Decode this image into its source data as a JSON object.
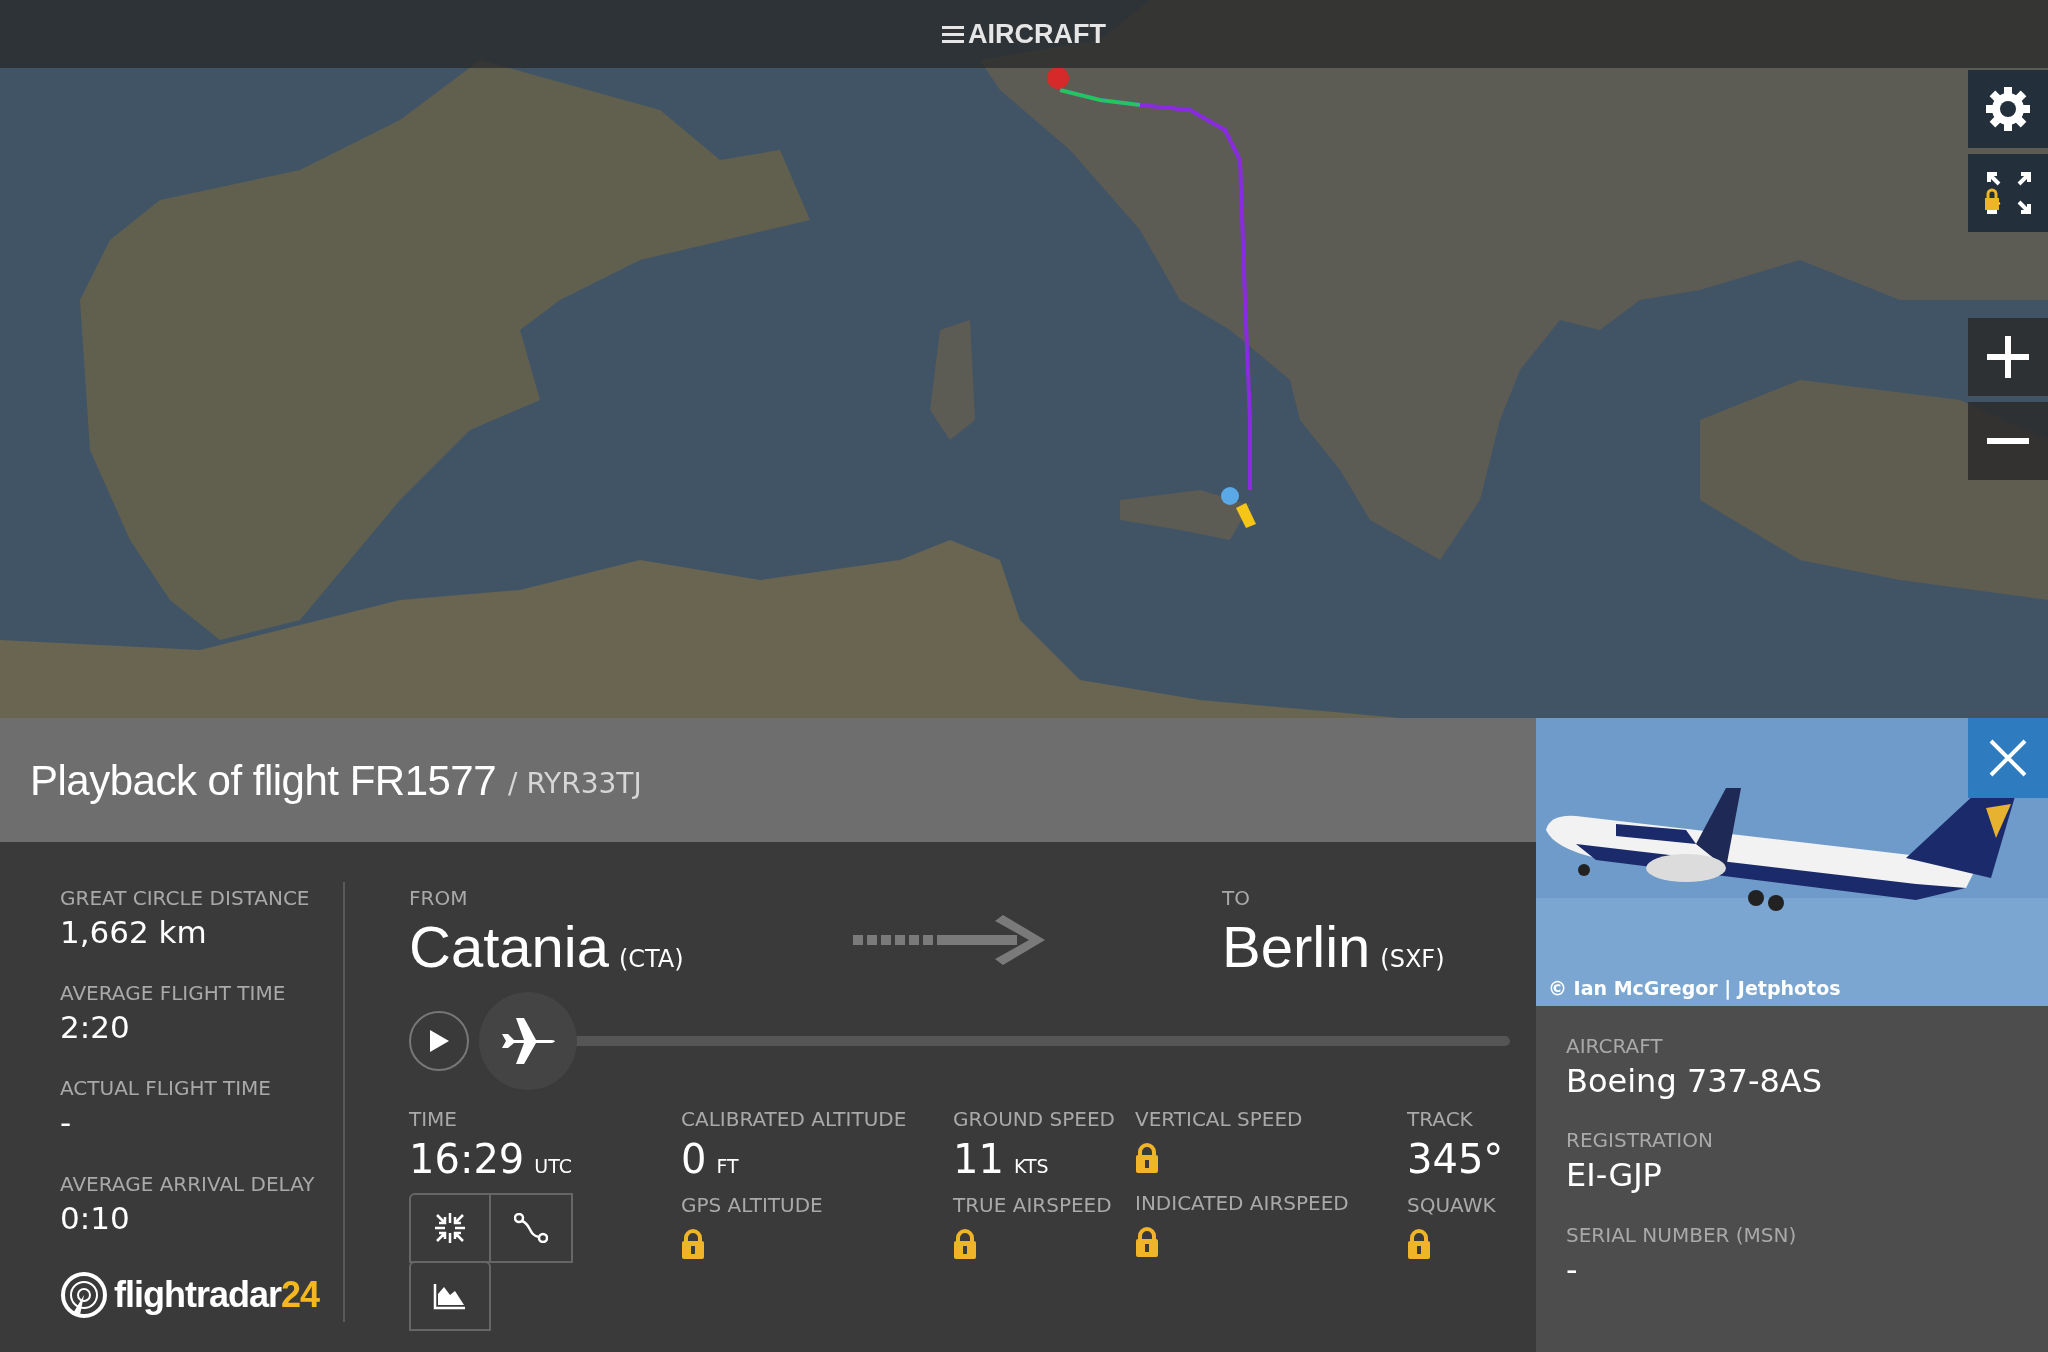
{
  "top_bar": {
    "title": "AIRCRAFT"
  },
  "flight_header": {
    "title": "Playback of flight FR1577",
    "callsign": "/ RYR33TJ"
  },
  "stats": [
    {
      "label": "GREAT CIRCLE DISTANCE",
      "value": "1,662 km"
    },
    {
      "label": "AVERAGE FLIGHT TIME",
      "value": "2:20"
    },
    {
      "label": "ACTUAL FLIGHT TIME",
      "value": "-"
    },
    {
      "label": "AVERAGE ARRIVAL DELAY",
      "value": "0:10"
    }
  ],
  "logo": {
    "name": "flightradar",
    "suffix": "24"
  },
  "route": {
    "from_label": "FROM",
    "from_city": "Catania",
    "from_code": "(CTA)",
    "to_label": "TO",
    "to_city": "Berlin",
    "to_code": "(SXF)"
  },
  "playback": {
    "level": 0
  },
  "time": {
    "label": "TIME",
    "value": "16:29",
    "unit": "UTC"
  },
  "readouts": [
    [
      {
        "label": "CALIBRATED ALTITUDE",
        "value": "0",
        "unit": "FT",
        "locked": false
      },
      {
        "label": "GPS ALTITUDE",
        "locked": true
      }
    ],
    [
      {
        "label": "GROUND SPEED",
        "value": "11",
        "unit": "KTS",
        "locked": false
      },
      {
        "label": "TRUE AIRSPEED",
        "locked": true
      }
    ],
    [
      {
        "label": "VERTICAL SPEED",
        "locked": true
      },
      {
        "label": "INDICATED AIRSPEED",
        "locked": true
      }
    ],
    [
      {
        "label": "TRACK",
        "value": "345°",
        "locked": false
      },
      {
        "label": "SQUAWK",
        "locked": true
      }
    ]
  ],
  "photo": {
    "credit": "© Ian McGregor | Jetphotos"
  },
  "aircraft_details": [
    {
      "label": "AIRCRAFT",
      "value": "Boeing 737-8AS"
    },
    {
      "label": "REGISTRATION",
      "value": "EI-GJP"
    },
    {
      "label": "SERIAL NUMBER (MSN)",
      "value": "-"
    }
  ]
}
